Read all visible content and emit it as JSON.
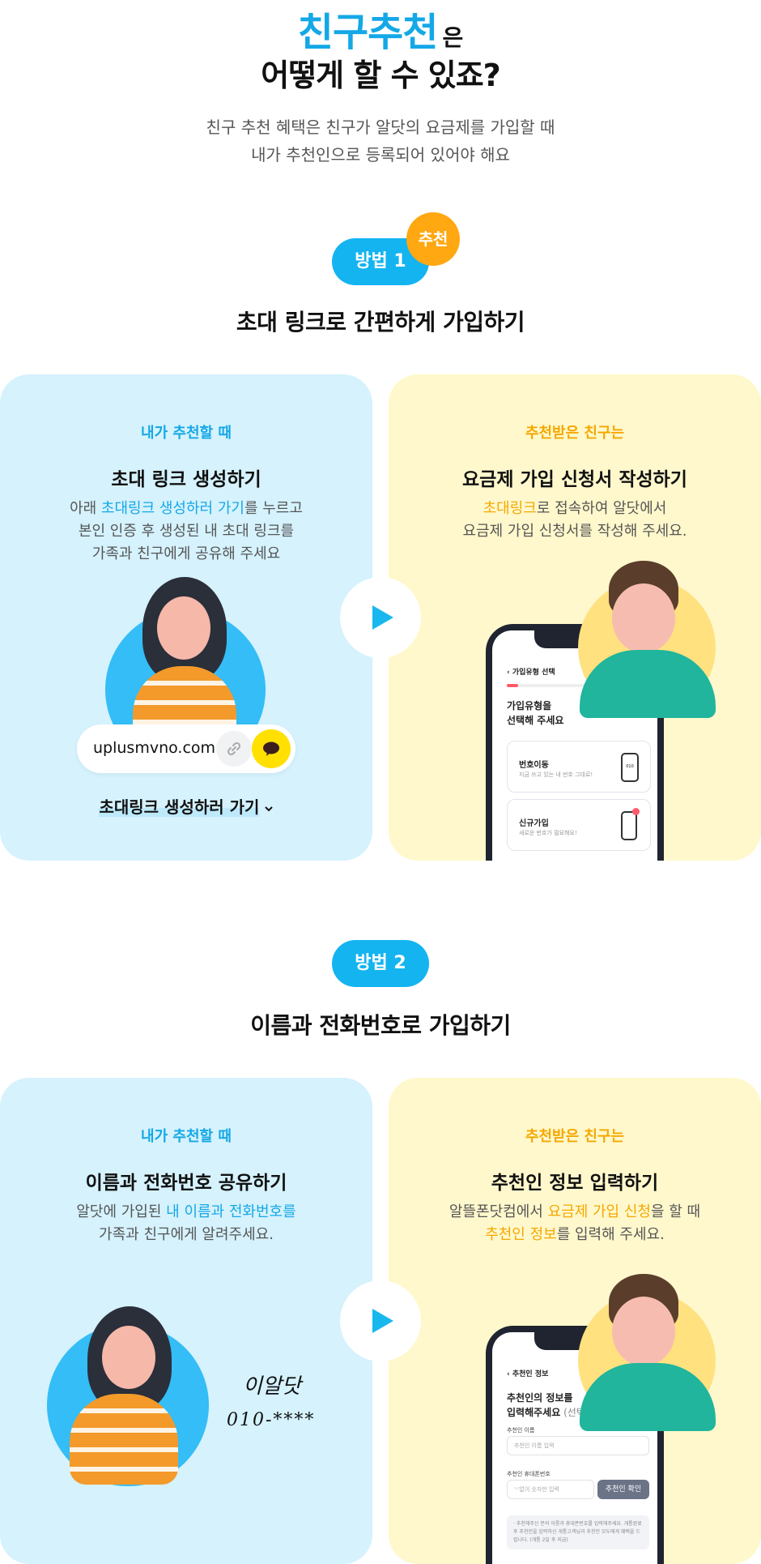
{
  "hero": {
    "brand": "친구추천",
    "suffix": "은",
    "title_line2": "어떻게 할 수 있죠?",
    "sub_line1": "친구 추천 혜택은 친구가 알닷의 요금제를 가입할 때",
    "sub_line2": "내가 추천인으로 등록되어 있어야 해요"
  },
  "method1": {
    "pill": "방법 1",
    "badge": "추천",
    "title": "초대 링크로 간편하게 가입하기",
    "left": {
      "eyebrow": "내가 추천할 때",
      "title": "초대 링크 생성하기",
      "desc_a": "아래 ",
      "desc_hl": "초대링크 생성하러 가기",
      "desc_b": "를 누르고",
      "desc_line2": "본인 인증 후 생성된 내 초대 링크를",
      "desc_line3": "가족과 친구에게 공유해 주세요",
      "url": "uplusmvno.com",
      "cta": "초대링크 생성하러 가기",
      "cta_icon": "chevron-down-icon"
    },
    "right": {
      "eyebrow": "추천받은 친구는",
      "title": "요금제 가입 신청서 작성하기",
      "desc_hl": "초대링크",
      "desc_a": "로 접속하여 알닷에서",
      "desc_line2": "요금제 가입 신청서를 작성해 주세요.",
      "phone": {
        "back_title": "가입유형 선택",
        "heading1": "가입유형을",
        "heading2": "선택해 주세요",
        "opt1_title": "번호이동",
        "opt1_sub": "지금 쓰고 있는 내 번호 그대로!",
        "opt2_title": "신규가입",
        "opt2_sub": "새로운 번호가 필요해요!",
        "opt1_badge": "010"
      }
    }
  },
  "method2": {
    "pill": "방법 2",
    "title": "이름과 전화번호로 가입하기",
    "left": {
      "eyebrow": "내가 추천할 때",
      "title": "이름과 전화번호 공유하기",
      "desc_a": "알닷에 가입된 ",
      "desc_hl": "내 이름과 전화번호를",
      "desc_line2": "가족과 친구에게 알려주세요.",
      "hand_name": "이알닷",
      "hand_phone": "010-****"
    },
    "right": {
      "eyebrow": "추천받은 친구는",
      "title": "추천인 정보 입력하기",
      "desc_a": "알뜰폰닷컴에서 ",
      "desc_hl1": "요금제 가입 신청",
      "desc_b": "을 할 때",
      "desc_hl2": "추천인 정보",
      "desc_c": "를 입력해 주세요.",
      "phone": {
        "back_title": "추천인 정보",
        "heading1": "추천인의 정보를",
        "heading2": "입력해주세요",
        "heading2_opt": " (선택)",
        "name_label": "추천인 이름",
        "name_placeholder": "추천인 이름 입력",
        "phone_label": "추천인 휴대폰번호",
        "phone_placeholder": "'-'없이 숫자만 입력",
        "confirm_btn": "추천인 확인",
        "notice": "· 추천해주신 분의 이름과 휴대폰번호를 입력해주세요. 개통완료 후 추천인을 입력하신 개통고객님과 추천인 모두에게 혜택을 드립니다. (개통 2달 후 지급)"
      }
    }
  },
  "colors": {
    "brand_blue": "#14a8e6",
    "accent_orange": "#f5a800",
    "card_blue": "#d5f2fd",
    "card_yellow": "#fff8cc",
    "kakao_yellow": "#ffe000"
  }
}
